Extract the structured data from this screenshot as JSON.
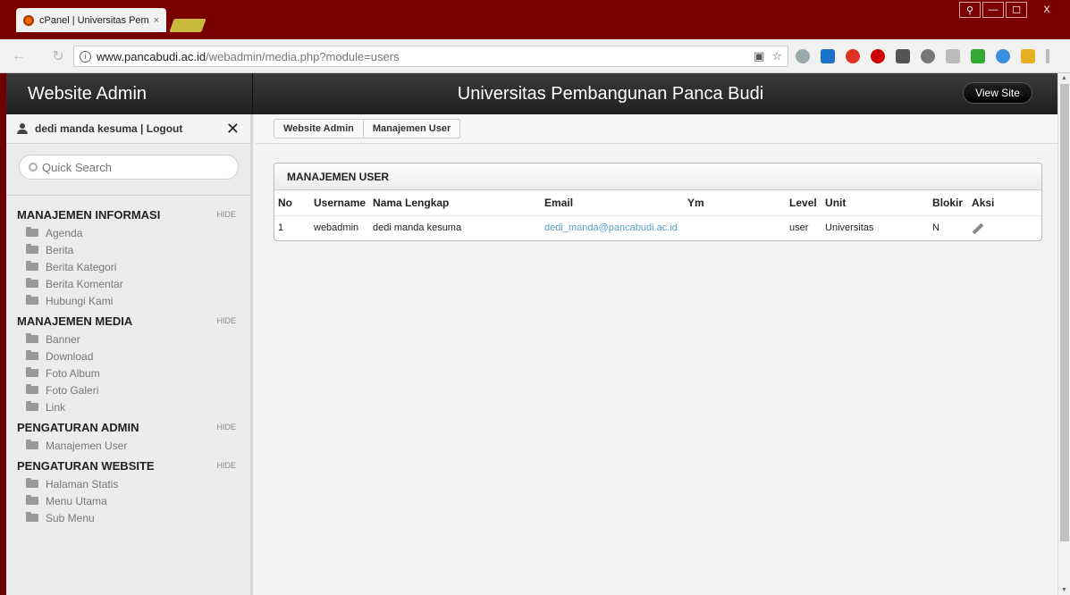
{
  "browser": {
    "tab_title": "cPanel | Universitas Pem",
    "tab_close": "×",
    "url_host": "www.pancabudi.ac.id",
    "url_path": "/webadmin/media.php?module=users",
    "window_buttons": [
      "—",
      "☐",
      "X"
    ]
  },
  "header": {
    "brand": "Website Admin",
    "site_title": "Universitas Pembangunan Panca Budi",
    "view_site_label": "View Site"
  },
  "sidebar": {
    "user_label": "dedi manda kesuma | Logout",
    "close_symbol": "✕",
    "search_placeholder": "Quick Search",
    "sections": [
      {
        "title": "MANAJEMEN INFORMASI",
        "hide_label": "HIDE",
        "items": [
          "Agenda",
          "Berita",
          "Berita Kategori",
          "Berita Komentar",
          "Hubungi Kami"
        ]
      },
      {
        "title": "MANAJEMEN MEDIA",
        "hide_label": "HIDE",
        "items": [
          "Banner",
          "Download",
          "Foto Album",
          "Foto Galeri",
          "Link"
        ]
      },
      {
        "title": "PENGATURAN ADMIN",
        "hide_label": "HIDE",
        "items": [
          "Manajemen User"
        ]
      },
      {
        "title": "PENGATURAN WEBSITE",
        "hide_label": "HIDE",
        "items": [
          "Halaman Statis",
          "Menu Utama",
          "Sub Menu"
        ]
      }
    ]
  },
  "breadcrumb": [
    "Website Admin",
    "Manajemen User"
  ],
  "panel": {
    "title": "MANAJEMEN USER",
    "columns": [
      "No",
      "Username",
      "Nama Lengkap",
      "Email",
      "Ym",
      "Level",
      "Unit",
      "Blokir",
      "Aksi"
    ],
    "rows": [
      [
        "1",
        "webadmin",
        "dedi manda kesuma",
        "dedi_manda@pancabudi.ac.id",
        "",
        "user",
        "Universitas",
        "N",
        ""
      ]
    ]
  },
  "colors": {
    "chrome_frame": "#7a0000",
    "header_dark": "#262626",
    "email_link": "#5aa0c8"
  }
}
